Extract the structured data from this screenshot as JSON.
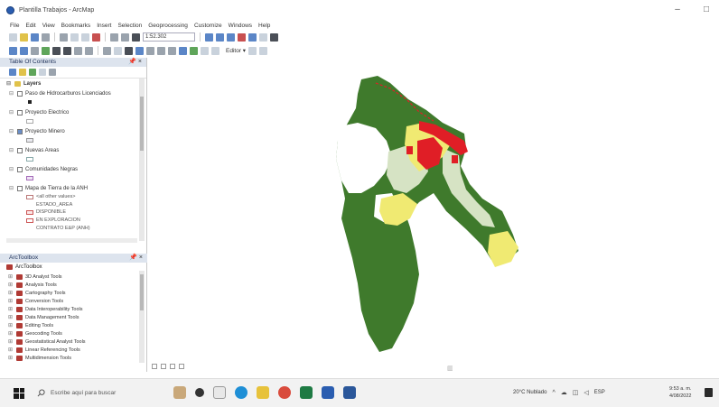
{
  "window": {
    "title": "Plantilla Trabajos - ArcMap",
    "minimize": "–",
    "maximize": "□"
  },
  "menu": [
    "File",
    "Edit",
    "View",
    "Bookmarks",
    "Insert",
    "Selection",
    "Geoprocessing",
    "Customize",
    "Windows",
    "Help"
  ],
  "toolbar": {
    "scale_value": "1:52.302",
    "editor_label": "Editor ▾"
  },
  "toc": {
    "title": "Table Of Contents",
    "pin": "📌 ×",
    "layers_label": "Layers",
    "items": [
      {
        "label": "Paso de Hidrocarburos Licenciados",
        "checked": false
      },
      {
        "label": "Proyecto Electrico",
        "checked": false
      },
      {
        "label": "Proyecto Minero",
        "checked": true
      },
      {
        "label": "Nuevas Areas",
        "checked": false
      },
      {
        "label": "Comunidades Negras",
        "checked": false
      },
      {
        "label": "Mapa de Tierra de la ANH",
        "checked": false
      }
    ],
    "sublegend": [
      "<all other values>",
      "ESTADO_AREA",
      "DISPONIBLE",
      "EN EXPLORACION",
      "CONTRATO E&P (ANH)"
    ]
  },
  "arctoolbox": {
    "title": "ArcToolbox",
    "pin": "📌 ×",
    "root": "ArcToolbox",
    "tools": [
      "3D Analyst Tools",
      "Analysis Tools",
      "Cartography Tools",
      "Conversion Tools",
      "Data Interoperability Tools",
      "Data Management Tools",
      "Editing Tools",
      "Geocoding Tools",
      "Geostatistical Analyst Tools",
      "Linear Referencing Tools",
      "Multidimension Tools"
    ]
  },
  "map": {
    "colors": {
      "dark_green": "#3f7a2c",
      "light_green": "#d6e3c4",
      "yellow": "#f0ea72",
      "red": "#e01e26"
    }
  },
  "taskbar": {
    "search_placeholder": "Escribe aquí para buscar",
    "weather": "20°C Nublado",
    "language": "ESP",
    "time": "9:53 a. m.",
    "date": "4/08/2022"
  },
  "icons": {
    "search": "search-icon",
    "windows": "windows-start-icon"
  }
}
